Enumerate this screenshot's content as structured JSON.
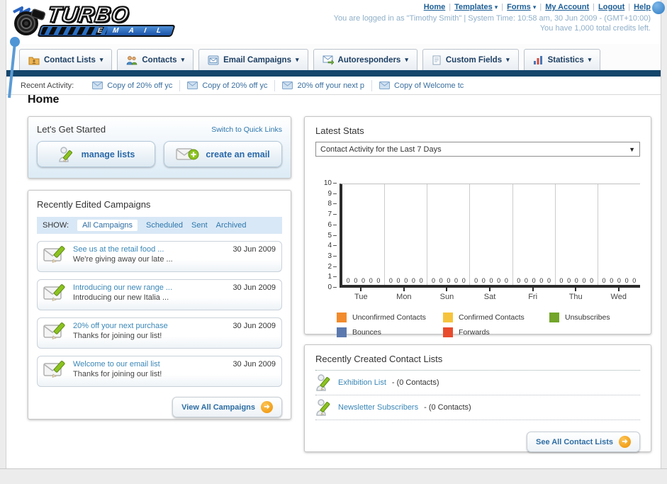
{
  "icons": {
    "dropdown_arrow": "▾",
    "select_arrow": "▼",
    "arrow_right": "➜",
    "separator": "|"
  },
  "header": {
    "logo_title": "TURBO",
    "logo_subtitle": "E M A I L",
    "nav_links": [
      {
        "label": "Home",
        "dropdown": false
      },
      {
        "label": "Templates",
        "dropdown": true
      },
      {
        "label": "Forms",
        "dropdown": true
      },
      {
        "label": "My Account",
        "dropdown": false
      },
      {
        "label": "Logout",
        "dropdown": false
      },
      {
        "label": "Help",
        "dropdown": false
      }
    ],
    "login_info": "You are logged in as \"Timothy Smith\" | System Time: 10:58 am, 30 Jun 2009 - (GMT+10:00)",
    "credits_info": "You have 1,000 total credits left."
  },
  "tabs": [
    {
      "label": "Contact Lists"
    },
    {
      "label": "Contacts"
    },
    {
      "label": "Email Campaigns"
    },
    {
      "label": "Autoresponders"
    },
    {
      "label": "Custom Fields"
    },
    {
      "label": "Statistics"
    }
  ],
  "recent_activity": {
    "label": "Recent Activity:",
    "items": [
      {
        "text": "Copy of 20% off yc"
      },
      {
        "text": "Copy of 20% off yc"
      },
      {
        "text": "20% off your next p"
      },
      {
        "text": "Copy of Welcome tc"
      }
    ]
  },
  "page_title": "Home",
  "get_started": {
    "title": "Let's Get Started",
    "switch_link": "Switch to Quick Links",
    "manage_lists_label": "manage lists",
    "create_email_label": "create an email"
  },
  "campaigns": {
    "title": "Recently Edited Campaigns",
    "show_label": "SHOW:",
    "filters": [
      {
        "label": "All Campaigns"
      },
      {
        "label": "Scheduled"
      },
      {
        "label": "Sent"
      },
      {
        "label": "Archived"
      }
    ],
    "active_filter": "All Campaigns",
    "items": [
      {
        "title": "See us at the retail food ...",
        "subtitle": "We're giving away our late ...",
        "date": "30 Jun 2009"
      },
      {
        "title": "Introducing our new range ...",
        "subtitle": "Introducing our new Italia ...",
        "date": "30 Jun 2009"
      },
      {
        "title": "20% off your next purchase",
        "subtitle": "Thanks for joining our list!",
        "date": "30 Jun 2009"
      },
      {
        "title": "Welcome to our email list",
        "subtitle": "Thanks for joining our list!",
        "date": "30 Jun 2009"
      }
    ],
    "view_all_label": "View All Campaigns"
  },
  "latest_stats": {
    "title": "Latest Stats",
    "dropdown_value": "Contact Activity for the Last 7 Days"
  },
  "chart_data": {
    "type": "bar",
    "title": "Contact Activity for the Last 7 Days",
    "categories": [
      "Tue",
      "Mon",
      "Sun",
      "Sat",
      "Fri",
      "Thu",
      "Wed"
    ],
    "series": [
      {
        "name": "Unconfirmed Contacts",
        "color": "#f28b2c",
        "values": [
          0,
          0,
          0,
          0,
          0,
          0,
          0
        ]
      },
      {
        "name": "Confirmed Contacts",
        "color": "#f6c43c",
        "values": [
          0,
          0,
          0,
          0,
          0,
          0,
          0
        ]
      },
      {
        "name": "Unsubscribes",
        "color": "#72a52a",
        "values": [
          0,
          0,
          0,
          0,
          0,
          0,
          0
        ]
      },
      {
        "name": "Bounces",
        "color": "#5b79ae",
        "values": [
          0,
          0,
          0,
          0,
          0,
          0,
          0
        ]
      },
      {
        "name": "Forwards",
        "color": "#e84b2c",
        "values": [
          0,
          0,
          0,
          0,
          0,
          0,
          0
        ]
      }
    ],
    "ylim": [
      0,
      10
    ],
    "yticks": [
      0,
      1,
      2,
      3,
      4,
      5,
      6,
      7,
      8,
      9,
      10
    ],
    "xlabel": "",
    "ylabel": "",
    "grid": true,
    "legend_position": "bottom"
  },
  "contact_lists": {
    "title": "Recently Created Contact Lists",
    "items": [
      {
        "name": "Exhibition List",
        "count": "- (0 Contacts)"
      },
      {
        "name": "Newsletter Subscribers",
        "count": "- (0 Contacts)"
      }
    ],
    "see_all_label": "See All Contact Lists"
  }
}
